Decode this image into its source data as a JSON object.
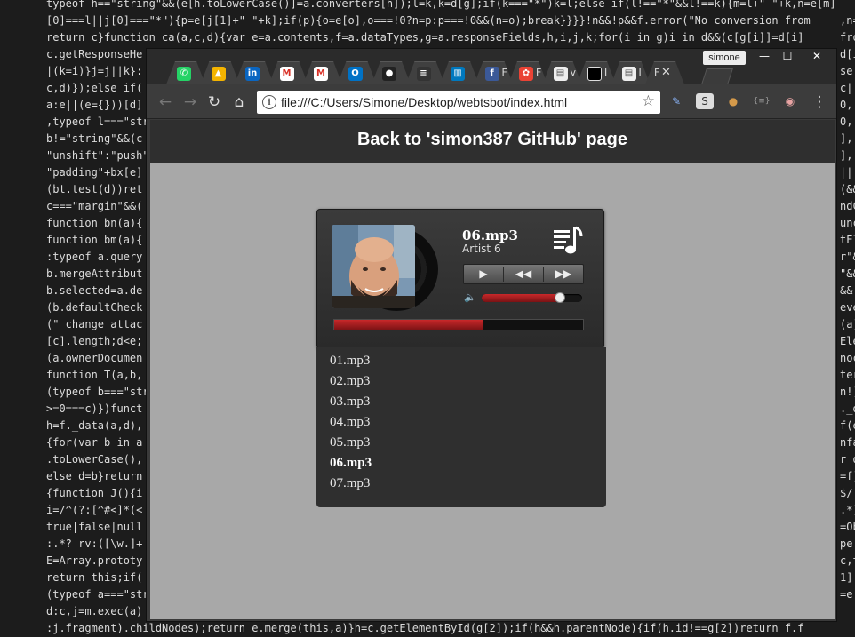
{
  "background_code": {
    "lines": [
      "typeof h==\"string\"&&(e[h.toLowerCase()]=a.converters[h]);l=k,k=d[g];if(k===\"*\")k=l;else if(l!==\"*\"&&l!==k){m=l+\" \"+k,n=e[m]",
      "[0]===l||j[0]===\"*\"){p=e[j[1]+\" \"+k];if(p){o=e[o],o===!0?n=p:p===!0&&(n=o);break}}}}!n&&!p&&f.error(\"No conversion from",
      "return c}function ca(a,c,d){var e=a.contents,f=a.dataTypes,g=a.responseFields,h,i,j,k;for(i in g)i in d&&(c[g[i]]=d[i]",
      "c.getResponseHe",
      "|(k=i)}j=j||k}:",
      "c,d)});else if(",
      "a:e||(e={}))[d]",
      ",typeof l===\"str",
      "b!=\"string\"&&(c",
      "\"unshift\":\"push\"",
      "\"padding\"+bx[e]",
      "(bt.test(d))ret",
      "c===\"margin\"&&(",
      "function bn(a){",
      "function bm(a){",
      ":typeof a.query",
      "b.mergeAttribut",
      "b.selected=a.de",
      "(b.defaultCheck",
      "(\"_change_attac",
      "[c].length;d<e;",
      "(a.ownerDocumen",
      "function T(a,b,",
      "(typeof b===\"str",
      ">=0===c)})funct",
      "h=f._data(a,d),",
      "{for(var b in a",
      ".toLowerCase(),",
      "else d=b}return",
      "{function J(){i",
      "i=/^(?:[^#<]*(<",
      "true|false|null",
      ":.*? rv:([\\w.]+",
      "E=Array.prototy",
      "return this;if(",
      "(typeof a===\"str",
      "d:c,j=m.exec(a)",
      ":j.fragment).childNodes);return e.merge(this,a)}h=c.getElementById(g[2]);if(h&&h.parentNode){if(h.id!==g[2])return f.f"
    ],
    "right_column": [
      "",
      ",n=e[m]",
      "from",
      "d[i]",
      "se|",
      "c|",
      "0,",
      "0,",
      "],",
      "],",
      "||(",
      "(&&",
      "ndC",
      "unc",
      "tEl",
      "r\"&",
      "\"&&",
      "&&",
      "eve",
      "(a)",
      "Ele",
      "noc",
      "ter",
      "n!)",
      "._d",
      "f(e",
      "nfa",
      "r d",
      "=f)",
      "$/,",
      ".*)",
      "=Ob",
      "pe",
      "c,t",
      "1]",
      "=e"
    ]
  },
  "tabs": [
    {
      "icon": "whatsapp-icon",
      "title": ""
    },
    {
      "icon": "google-drive-icon",
      "title": ""
    },
    {
      "icon": "linkedin-icon",
      "title": ""
    },
    {
      "icon": "gmail-icon",
      "title": ""
    },
    {
      "icon": "gmail-icon",
      "title": ""
    },
    {
      "icon": "outlook-icon",
      "title": ""
    },
    {
      "icon": "github-icon",
      "title": ""
    },
    {
      "icon": "stackoverflow-icon",
      "title": ""
    },
    {
      "icon": "trello-icon",
      "title": ""
    },
    {
      "icon": "facebook-icon",
      "title": "F"
    },
    {
      "icon": "photos-icon",
      "title": "F"
    },
    {
      "icon": "document-icon",
      "title": "v"
    },
    {
      "icon": "black-square-icon",
      "title": "I"
    },
    {
      "icon": "document-icon",
      "title": "I"
    },
    {
      "icon": "",
      "title": "F",
      "close": "✕"
    }
  ],
  "profile_name": "simone",
  "window_controls": {
    "minimize": "—",
    "maximize": "☐",
    "close": "✕"
  },
  "toolbar": {
    "back": "←",
    "forward": "→",
    "reload": "↻",
    "home": "⌂",
    "url": "file:///C:/Users/Simone/Desktop/webtsbot/index.html",
    "info": "i",
    "bookmark": "☆",
    "extensions": [
      {
        "name": "pen-icon",
        "glyph": "✎"
      },
      {
        "name": "s-extension-icon",
        "glyph": "S"
      },
      {
        "name": "cookie-icon",
        "glyph": "●"
      },
      {
        "name": "json-icon",
        "glyph": "{≡}"
      },
      {
        "name": "brain-icon",
        "glyph": "◉"
      }
    ],
    "menu": "⋮"
  },
  "page": {
    "title": "Back to 'simon387 GitHub' page",
    "player": {
      "track_title": "06.mp3",
      "artist": "Artist 6",
      "buttons": {
        "play": "▶",
        "rewind": "◀◀",
        "forward": "▶▶"
      },
      "volume_icon": "🔈",
      "volume_level": 0.78,
      "progress": 0.6
    },
    "playlist": [
      "01.mp3",
      "02.mp3",
      "03.mp3",
      "04.mp3",
      "05.mp3",
      "06.mp3",
      "07.mp3"
    ],
    "current_index": 5
  },
  "colors": {
    "accent_red": "#b8191b",
    "page_background": "#a8a8a8",
    "header_background": "#2f2f2f"
  }
}
